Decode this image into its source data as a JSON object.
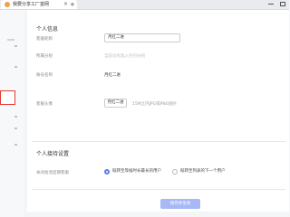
{
  "browser": {
    "tab_title": "我要分享工厂首网",
    "tab_close": "×",
    "new_tab": "+"
  },
  "profile": {
    "section_title": "个人信息",
    "nickname_label": "客服昵称",
    "nickname_value": "月红二进",
    "group_label": "所属分组",
    "group_placeholder": "当前没有加入任何分组",
    "account_label": "账号名称",
    "account_value": "月红二进",
    "avatar_label": "客服头像",
    "avatar_button": "月红二进",
    "avatar_hint": "15M之内JPG或PNG图片"
  },
  "reception": {
    "section_title": "个人接待设置",
    "session_label": "关闭会话后期客服",
    "options": [
      {
        "label": "既转至等候时长最长的用户",
        "checked": true
      },
      {
        "label": "既转至列表的下一个用户",
        "checked": false
      }
    ]
  },
  "actions": {
    "save_label": "保存并生效"
  },
  "colors": {
    "accent": "#5b7cf0",
    "save_button_bg": "#a8b8f7",
    "highlight_border": "#e53935"
  }
}
